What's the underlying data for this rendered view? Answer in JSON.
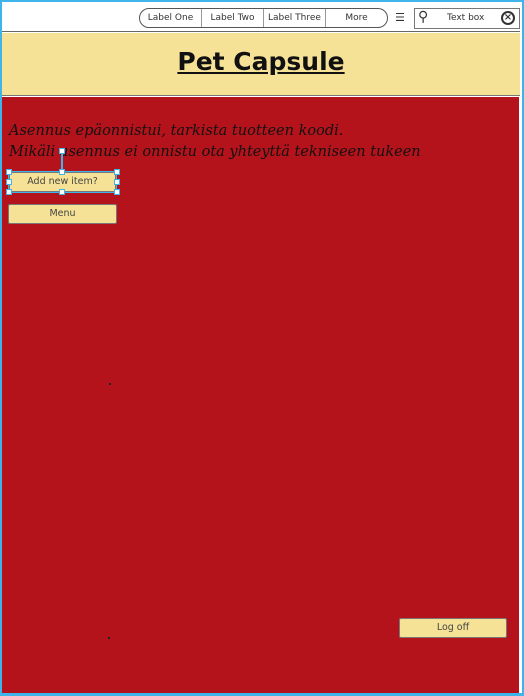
{
  "nav": {
    "tabs": [
      "Label One",
      "Label Two",
      "Label Three",
      "More"
    ],
    "list_icon": "list-icon"
  },
  "search": {
    "placeholder": "Text box",
    "icons": [
      "search-icon",
      "clear-icon"
    ]
  },
  "header": {
    "title": "Pet Capsule"
  },
  "main": {
    "message_line1": "Asennus epäonnistui, tarkista tuotteen koodi.",
    "message_line2": "Mikäli asennus ei onnistu ota yhteyttä tekniseen tukeen",
    "add_button": "Add new item?",
    "menu_button": "Menu",
    "logoff_button": "Log off"
  },
  "colors": {
    "background": "#b5131b",
    "accent": "#f5e296",
    "frame": "#3fb4ea"
  }
}
